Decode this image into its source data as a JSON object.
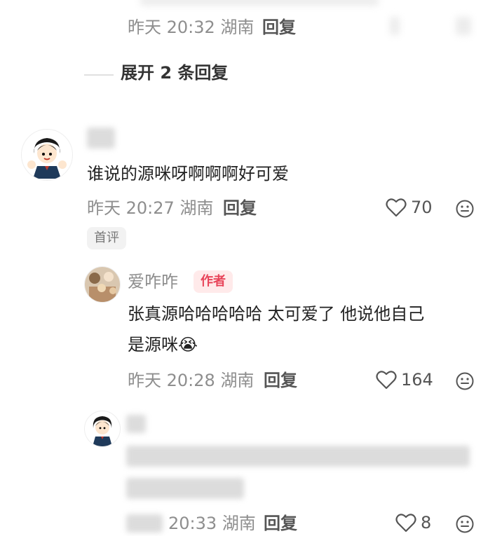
{
  "comment0": {
    "time": "昨天 20:32",
    "location": "湖南",
    "reply_label": "回复"
  },
  "expand": {
    "label": "展开 2 条回复"
  },
  "comment1": {
    "text": "谁说的源咪呀啊啊啊好可爱",
    "time": "昨天 20:27",
    "location": "湖南",
    "reply_label": "回复",
    "likes": "70",
    "badge": "首评"
  },
  "reply1": {
    "username": "爱咋咋",
    "author_badge": "作者",
    "text_line1": "张真源哈哈哈哈哈 太可爱了 他说他自己",
    "text_line2": "是源咪",
    "emoji": "😭",
    "time": "昨天 20:28",
    "location": "湖南",
    "reply_label": "回复",
    "likes": "164"
  },
  "reply2": {
    "time": "20:33",
    "location": "湖南",
    "reply_label": "回复",
    "likes": "8"
  },
  "icons": {
    "like": "heart-outline-icon",
    "emoji_reaction": "smiley-face-icon",
    "avatar": "anime-character-avatar"
  }
}
